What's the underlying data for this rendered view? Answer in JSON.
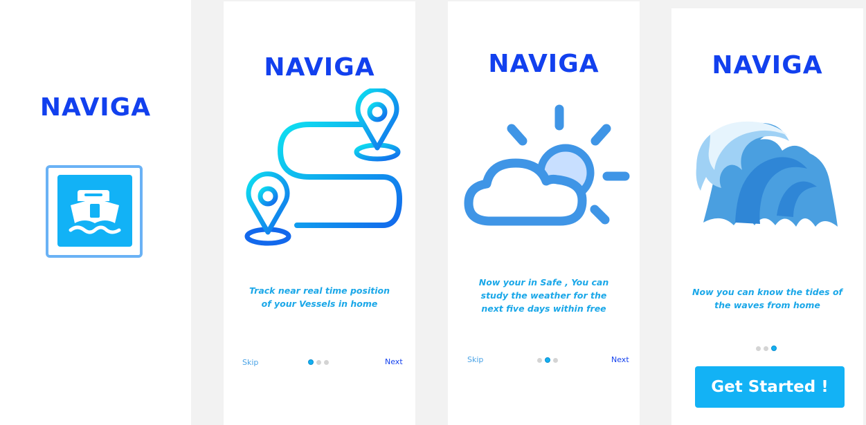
{
  "brand": {
    "name": "NAVIGA",
    "color": "#1240ee",
    "accent": "#13b2f5"
  },
  "screens": [
    {
      "id": "splash",
      "title": "NAVIGA",
      "icon": "ship-icon"
    },
    {
      "id": "onboarding-1",
      "title": "NAVIGA",
      "icon": "route-map-pins-icon",
      "caption": "Track near real time position of your Vessels in home",
      "skip_label": "Skip",
      "next_label": "Next",
      "active_page": 1,
      "page_count": 3
    },
    {
      "id": "onboarding-2",
      "title": "NAVIGA",
      "icon": "sun-behind-cloud-icon",
      "caption": "Now your in Safe , You can study the weather for the next five days within free",
      "skip_label": "Skip",
      "next_label": "Next",
      "active_page": 2,
      "page_count": 3
    },
    {
      "id": "onboarding-3",
      "title": "NAVIGA",
      "icon": "ocean-wave-icon",
      "caption": "Now you can know the tides of the waves from home",
      "active_page": 3,
      "page_count": 3,
      "cta_label": "Get Started !"
    }
  ]
}
